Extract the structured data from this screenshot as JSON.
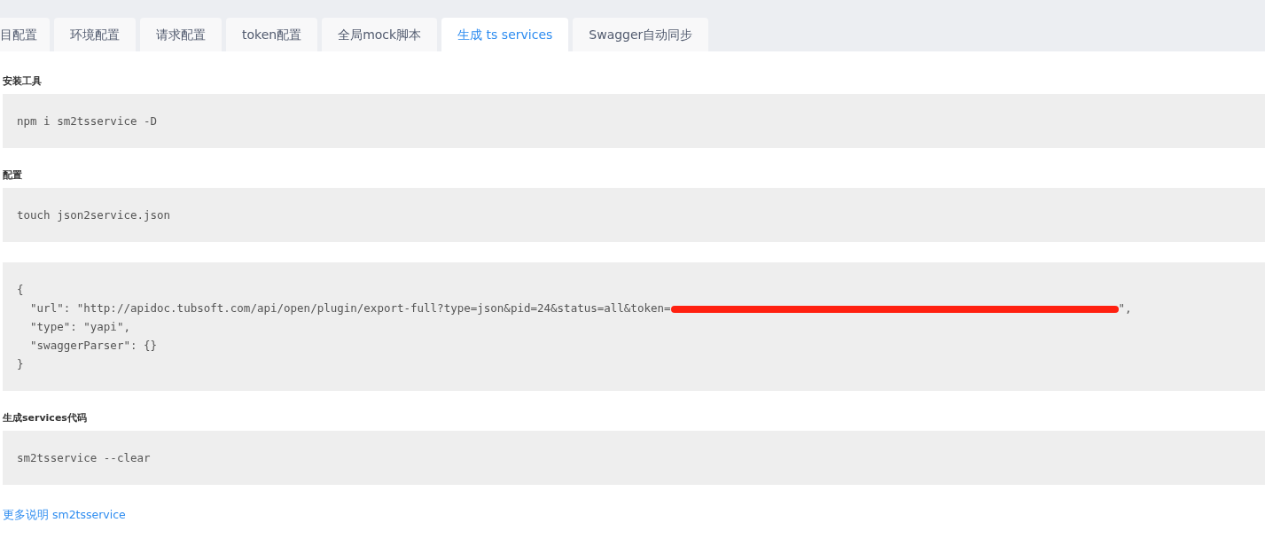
{
  "tabs": [
    {
      "label": "目配置",
      "selected": false
    },
    {
      "label": "环境配置",
      "selected": false
    },
    {
      "label": "请求配置",
      "selected": false
    },
    {
      "label": "token配置",
      "selected": false
    },
    {
      "label": "全局mock脚本",
      "selected": false
    },
    {
      "label": "生成 ts services",
      "selected": true
    },
    {
      "label": "Swagger自动同步",
      "selected": false
    }
  ],
  "sections": [
    {
      "heading": "安装工具",
      "lines": [
        {
          "text": "npm i sm2tsservice -D",
          "redacted": false
        }
      ]
    },
    {
      "heading": "配置",
      "lines": [
        {
          "text": "touch json2service.json",
          "redacted": false
        }
      ]
    },
    {
      "lines": [
        {
          "text": "{",
          "redacted": false
        },
        {
          "text": "  \"url\": \"http://apidoc.tubsoft.com/api/open/plugin/export-full?type=json&pid=24&status=all&token=",
          "redacted": true,
          "tail": "\","
        },
        {
          "text": "  \"type\": \"yapi\",",
          "redacted": false
        },
        {
          "text": "  \"swaggerParser\": {}",
          "redacted": false
        },
        {
          "text": "}",
          "redacted": false
        }
      ]
    },
    {
      "heading": "生成services代码",
      "lines": [
        {
          "text": "sm2tsservice --clear",
          "redacted": false
        }
      ]
    }
  ],
  "link": "更多说明 sm2tsservice"
}
